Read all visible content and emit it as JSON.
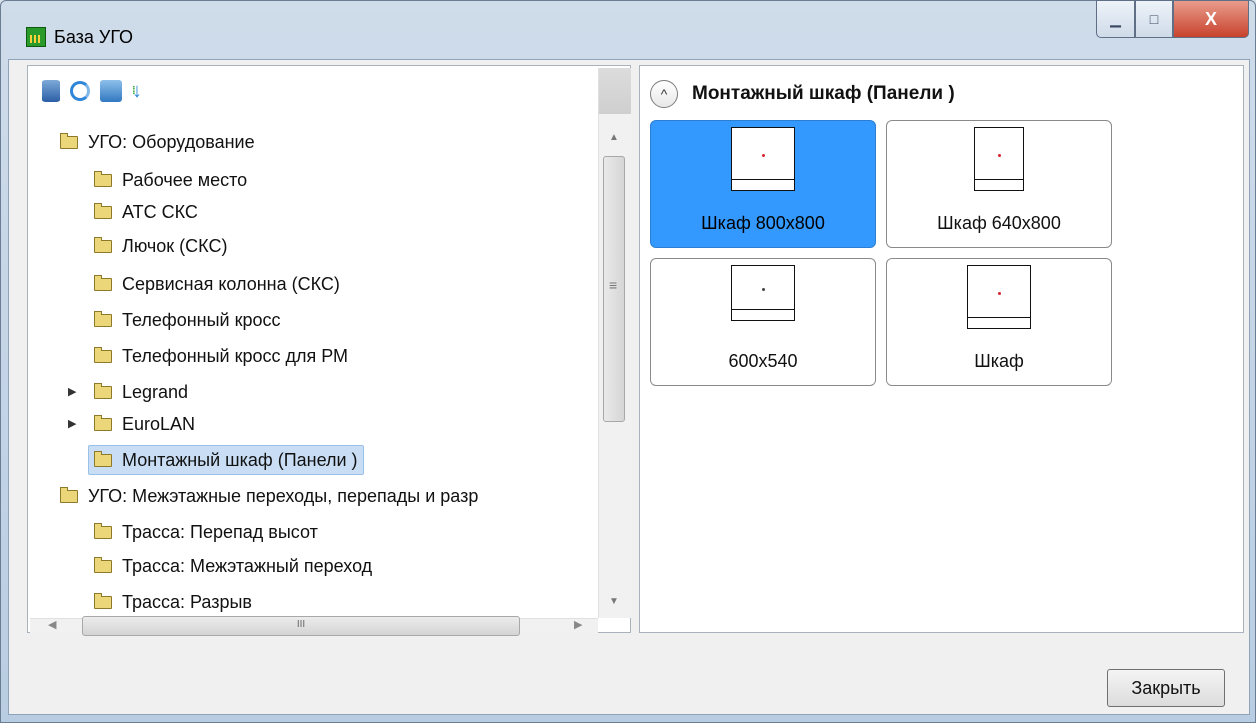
{
  "window": {
    "title": "База УГО",
    "buttons": {
      "minimize": "▁",
      "maximize": "□",
      "close": "X"
    }
  },
  "toolbar": {
    "icons": [
      "database-icon",
      "refresh-icon",
      "sync-icon",
      "sort-icon"
    ]
  },
  "tree": {
    "items": [
      {
        "label": "УГО: Оборудование",
        "level": 0,
        "expander": ""
      },
      {
        "label": "Рабочее место",
        "level": 1,
        "expander": ""
      },
      {
        "label": "АТС СКС",
        "level": 1,
        "expander": ""
      },
      {
        "label": "Лючок (СКС)",
        "level": 1,
        "expander": ""
      },
      {
        "label": "Сервисная колонна (СКС)",
        "level": 1,
        "expander": ""
      },
      {
        "label": "Телефонный кросс",
        "level": 1,
        "expander": ""
      },
      {
        "label": "Телефонный кросс для РМ",
        "level": 1,
        "expander": ""
      },
      {
        "label": "Legrand",
        "level": 1,
        "expander": "▶"
      },
      {
        "label": "EuroLAN",
        "level": 1,
        "expander": "▶"
      },
      {
        "label": "Монтажный шкаф (Панели )",
        "level": 1,
        "expander": "",
        "selected": true
      },
      {
        "label": "УГО: Межэтажные переходы, перепады и раз‌р",
        "level": 0,
        "expander": ""
      },
      {
        "label": "Трасса: Перепад высот",
        "level": 1,
        "expander": ""
      },
      {
        "label": "Трасса: Межэтажный переход",
        "level": 1,
        "expander": ""
      },
      {
        "label": "Трасса: Разрыв",
        "level": 1,
        "expander": ""
      }
    ]
  },
  "scrollbars": {
    "vertical_grip": "≡",
    "horizontal_grip": "III"
  },
  "group": {
    "collapse_symbol": "^",
    "title": "Монтажный шкаф (Панели )"
  },
  "tiles": [
    {
      "label": "Шкаф 800x800",
      "selected": true
    },
    {
      "label": "Шкаф 640x800",
      "selected": false
    },
    {
      "label": "600x540",
      "selected": false
    },
    {
      "label": "Шкаф",
      "selected": false
    }
  ],
  "footer": {
    "close_label": "Закрыть"
  }
}
